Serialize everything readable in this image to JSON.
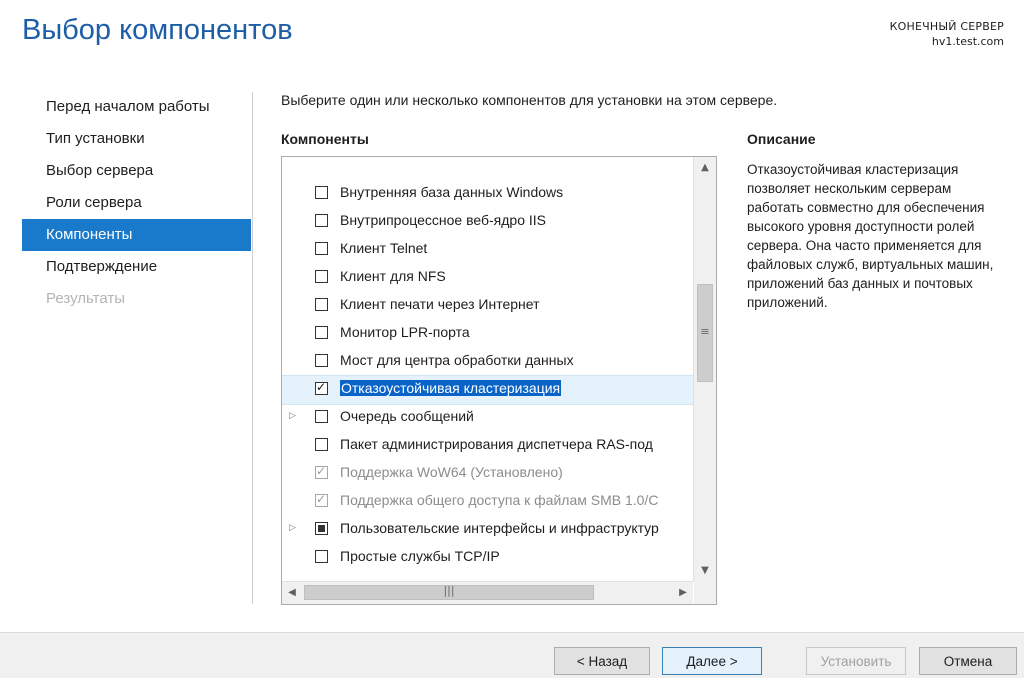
{
  "page": {
    "title": "Выбор компонентов"
  },
  "target_server": {
    "label": "КОНЕЧНЫЙ СЕРВЕР",
    "name": "hv1.test.com"
  },
  "nav": {
    "items": [
      {
        "label": "Перед началом работы",
        "state": "normal"
      },
      {
        "label": "Тип установки",
        "state": "normal"
      },
      {
        "label": "Выбор сервера",
        "state": "normal"
      },
      {
        "label": "Роли сервера",
        "state": "normal"
      },
      {
        "label": "Компоненты",
        "state": "active"
      },
      {
        "label": "Подтверждение",
        "state": "normal"
      },
      {
        "label": "Результаты",
        "state": "disabled"
      }
    ]
  },
  "content": {
    "prompt": "Выберите один или несколько компонентов для установки на этом сервере.",
    "components_header": "Компоненты",
    "description_header": "Описание",
    "description": "Отказоустойчивая кластеризация позволяет нескольким серверам работать совместно для обеспечения высокого уровня доступности ролей сервера. Она часто применяется для файловых служб, виртуальных машин, приложений баз данных и почтовых приложений."
  },
  "components": [
    {
      "label": "Внутренняя база данных Windows",
      "state": "unchecked",
      "expandable": false,
      "grey": false
    },
    {
      "label": "Внутрипроцессное веб-ядро IIS",
      "state": "unchecked",
      "expandable": false,
      "grey": false
    },
    {
      "label": "Клиент Telnet",
      "state": "unchecked",
      "expandable": false,
      "grey": false
    },
    {
      "label": "Клиент для NFS",
      "state": "unchecked",
      "expandable": false,
      "grey": false
    },
    {
      "label": "Клиент печати через Интернет",
      "state": "unchecked",
      "expandable": false,
      "grey": false
    },
    {
      "label": "Монитор LPR-порта",
      "state": "unchecked",
      "expandable": false,
      "grey": false
    },
    {
      "label": "Мост для центра обработки данных",
      "state": "unchecked",
      "expandable": false,
      "grey": false
    },
    {
      "label": "Отказоустойчивая кластеризация",
      "state": "checked",
      "expandable": false,
      "grey": false,
      "selected": true
    },
    {
      "label": "Очередь сообщений",
      "state": "unchecked",
      "expandable": true,
      "grey": false
    },
    {
      "label": "Пакет администрирования диспетчера RAS-под",
      "state": "unchecked",
      "expandable": false,
      "grey": false
    },
    {
      "label": "Поддержка WoW64 (Установлено)",
      "state": "checked",
      "expandable": false,
      "grey": true
    },
    {
      "label": "Поддержка общего доступа к файлам SMB 1.0/C",
      "state": "checked",
      "expandable": false,
      "grey": true
    },
    {
      "label": "Пользовательские интерфейсы и инфраструктур",
      "state": "partial",
      "expandable": true,
      "grey": false
    },
    {
      "label": "Простые службы TCP/IP",
      "state": "unchecked",
      "expandable": false,
      "grey": false
    }
  ],
  "buttons": {
    "back": "< Назад",
    "next": "Далее >",
    "install": "Установить",
    "cancel": "Отмена"
  },
  "icons": {
    "scroll_up": "▲",
    "scroll_down": "▼",
    "scroll_left": "◀",
    "scroll_right": "▶",
    "expand": "▷"
  }
}
